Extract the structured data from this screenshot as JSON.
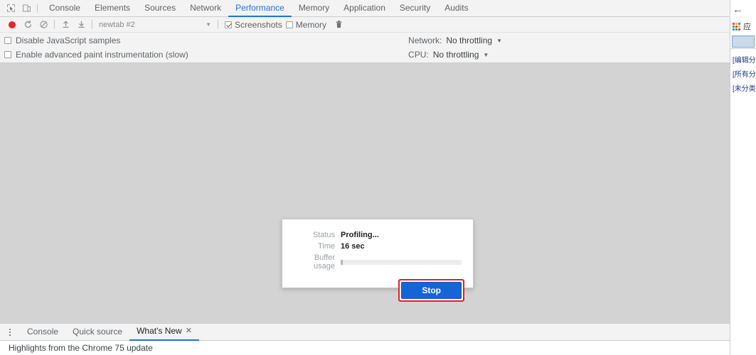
{
  "devtools": {
    "left_icons": [
      {
        "name": "inspect-element-icon",
        "title": "Inspect element"
      },
      {
        "name": "device-toolbar-icon",
        "title": "Toggle device toolbar"
      }
    ],
    "tabs": [
      {
        "label": "Console",
        "active": false
      },
      {
        "label": "Elements",
        "active": false
      },
      {
        "label": "Sources",
        "active": false
      },
      {
        "label": "Network",
        "active": false
      },
      {
        "label": "Performance",
        "active": true
      },
      {
        "label": "Memory",
        "active": false
      },
      {
        "label": "Application",
        "active": false
      },
      {
        "label": "Security",
        "active": false
      },
      {
        "label": "Audits",
        "active": false
      }
    ],
    "controls": {
      "record_title": "Record",
      "reload_title": "Start profiling and reload page",
      "clear_title": "Clear",
      "load_title": "Load profile",
      "save_title": "Save profile",
      "session_value": "newtab #2",
      "session_caret": "▼",
      "screenshots_label": "Screenshots",
      "screenshots_checked": true,
      "memory_label": "Memory",
      "memory_checked": false,
      "trash_title": "Collect garbage"
    },
    "settings": {
      "disable_js_samples_label": "Disable JavaScript samples",
      "disable_js_samples_checked": false,
      "advanced_paint_label": "Enable advanced paint instrumentation (slow)",
      "advanced_paint_checked": false,
      "network_label": "Network:",
      "network_value": "No throttling",
      "network_caret": "▼",
      "cpu_label": "CPU:",
      "cpu_value": "No throttling",
      "cpu_caret": "▼"
    },
    "status_dialog": {
      "status_label": "Status",
      "status_value": "Profiling...",
      "time_label": "Time",
      "time_value": "16 sec",
      "buffer_label": "Buffer usage",
      "buffer_percent": 2,
      "stop_label": "Stop",
      "highlight_color": "#e02020",
      "button_color": "#1665d8"
    },
    "drawer": {
      "menu_title": "More tools",
      "tabs": [
        {
          "label": "Console",
          "active": false,
          "closable": false
        },
        {
          "label": "Quick source",
          "active": false,
          "closable": false
        },
        {
          "label": "What's New",
          "active": true,
          "closable": true,
          "close_glyph": "✕"
        }
      ],
      "body_text": "Highlights from the Chrome 75 update"
    }
  },
  "browser_sliver": {
    "back_glyph": "←",
    "apps_icon_name": "apps-grid-icon",
    "apps_colors": [
      "#e8453c",
      "#f9bb2d",
      "#4285f4",
      "#3aa757",
      "#e8453c",
      "#f9bb2d",
      "#4285f4",
      "#3aa757",
      "#e8453c"
    ],
    "apps_label": "应",
    "bookmarks": [
      {
        "label": "[编辑分"
      },
      {
        "label": "[所有分"
      },
      {
        "label": "[未分类"
      }
    ]
  }
}
